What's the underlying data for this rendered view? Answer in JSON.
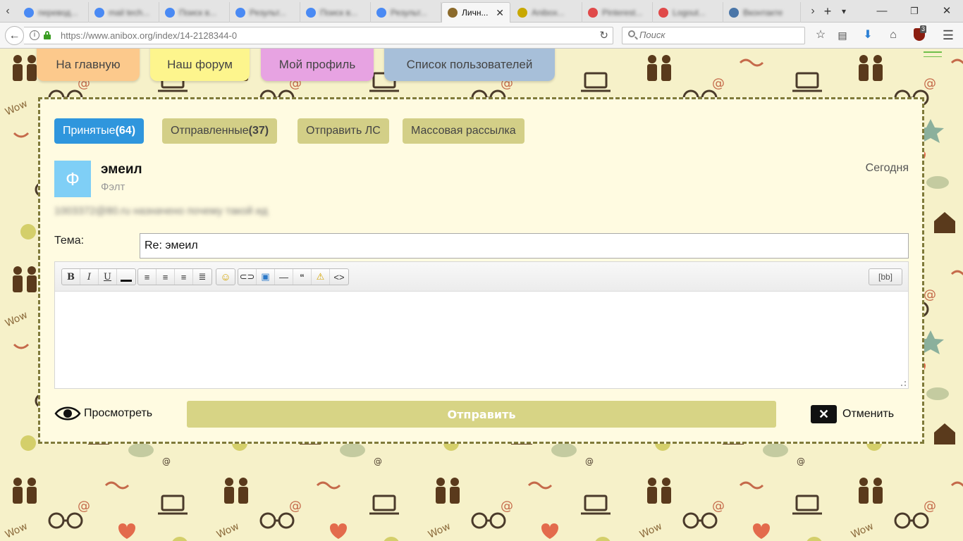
{
  "browser": {
    "tabs": [
      {
        "label": "перевод...",
        "color": "#4a8af4"
      },
      {
        "label": "mail tech...",
        "color": "#4a8af4"
      },
      {
        "label": "Поиск в...",
        "color": "#4a8af4"
      },
      {
        "label": "Результ...",
        "color": "#4a8af4"
      },
      {
        "label": "Поиск в...",
        "color": "#4a8af4"
      },
      {
        "label": "Результ...",
        "color": "#4a8af4"
      },
      {
        "label": "Личн...",
        "color": "#8b6a2b",
        "active": true
      },
      {
        "label": "Anibox...",
        "color": "#c8a800"
      },
      {
        "label": "Pinterest...",
        "color": "#e04a4a"
      },
      {
        "label": "Logout...",
        "color": "#e04a4a"
      },
      {
        "label": "Вконтакте",
        "color": "#4a76a8"
      }
    ],
    "url_domain": "https://www.anibox.org",
    "url_path": "/index/14-2128344-0",
    "search_placeholder": "Поиск",
    "ublock_count": "3",
    "icons": {
      "back": "back-arrow-icon",
      "info": "info-icon",
      "lock": "lock-icon",
      "reload": "reload-icon",
      "bookmark": "star-icon",
      "reader": "reading-list-icon",
      "downloads": "download-icon",
      "home": "home-icon",
      "addon": "ublock-icon",
      "menu": "hamburger-menu-icon"
    }
  },
  "site_nav": {
    "home": {
      "label": "На главную",
      "color": "#fcc98c"
    },
    "forum": {
      "label": "Наш форум",
      "color": "#fdf58d"
    },
    "profile": {
      "label": "Мой профиль",
      "color": "#e7a3e2"
    },
    "users": {
      "label": "Список пользователей",
      "color": "#a7bfd9"
    }
  },
  "pm_tabs": {
    "inbox_label": "Принятые",
    "inbox_count": "(64)",
    "sent_label": "Отправленные",
    "sent_count": "(37)",
    "compose": "Отправить ЛС",
    "mass": "Массовая рассылка",
    "active_color": "#2f96dd",
    "inactive_color": "#d3cf87"
  },
  "message": {
    "avatar_letter": "Ф",
    "title": "эмеил",
    "sender": "Фэлт",
    "date": "Сегодня",
    "body": "1003372@80.ru назначено почему такой ид"
  },
  "reply": {
    "subject_label": "Тема:",
    "subject_value": "Re: эмеил",
    "bb_label": "[bb]",
    "preview_label": "Просмотреть",
    "send_label": "Отправить",
    "cancel_label": "Отменить"
  }
}
